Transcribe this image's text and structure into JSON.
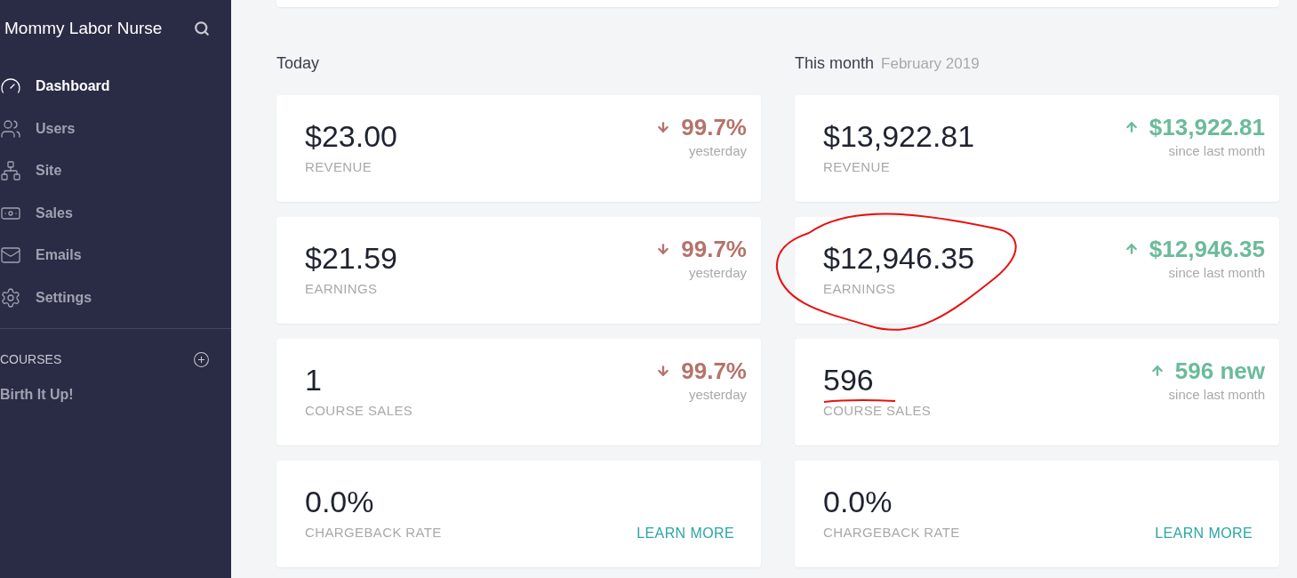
{
  "sidebar": {
    "brand": "Mommy Labor Nurse",
    "nav": [
      {
        "label": "Dashboard",
        "selected": true
      },
      {
        "label": "Users",
        "selected": false
      },
      {
        "label": "Site",
        "selected": false
      },
      {
        "label": "Sales",
        "selected": false
      },
      {
        "label": "Emails",
        "selected": false
      },
      {
        "label": "Settings",
        "selected": false
      }
    ],
    "section": "COURSES",
    "courses": [
      "Birth It Up!"
    ]
  },
  "columns": [
    {
      "title": "Today",
      "cards": [
        {
          "kind": "decrease",
          "value": "$23.00",
          "label": "REVENUE",
          "change": "99.7%",
          "period": "yesterday"
        },
        {
          "kind": "decrease",
          "value": "$21.59",
          "label": "EARNINGS",
          "change": "99.7%",
          "period": "yesterday"
        },
        {
          "kind": "decrease",
          "value": "1",
          "label": "COURSE SALES",
          "change": "99.7%",
          "period": "yesterday"
        },
        {
          "kind": "link",
          "value": "0.0%",
          "label": "CHARGEBACK RATE",
          "link": "LEARN MORE"
        }
      ]
    },
    {
      "title": "This month",
      "subtitle": "February 2019",
      "cards": [
        {
          "kind": "increase",
          "value": "$13,922.81",
          "label": "REVENUE",
          "change": "$13,922.81",
          "period": "since last month"
        },
        {
          "kind": "increase",
          "value": "$12,946.35",
          "label": "EARNINGS",
          "change": "$12,946.35",
          "period": "since last month"
        },
        {
          "kind": "increase",
          "value": "596",
          "label": "COURSE SALES",
          "change": "596 new",
          "period": "since last month"
        },
        {
          "kind": "link",
          "value": "0.0%",
          "label": "CHARGEBACK RATE",
          "link": "LEARN MORE"
        }
      ]
    }
  ]
}
